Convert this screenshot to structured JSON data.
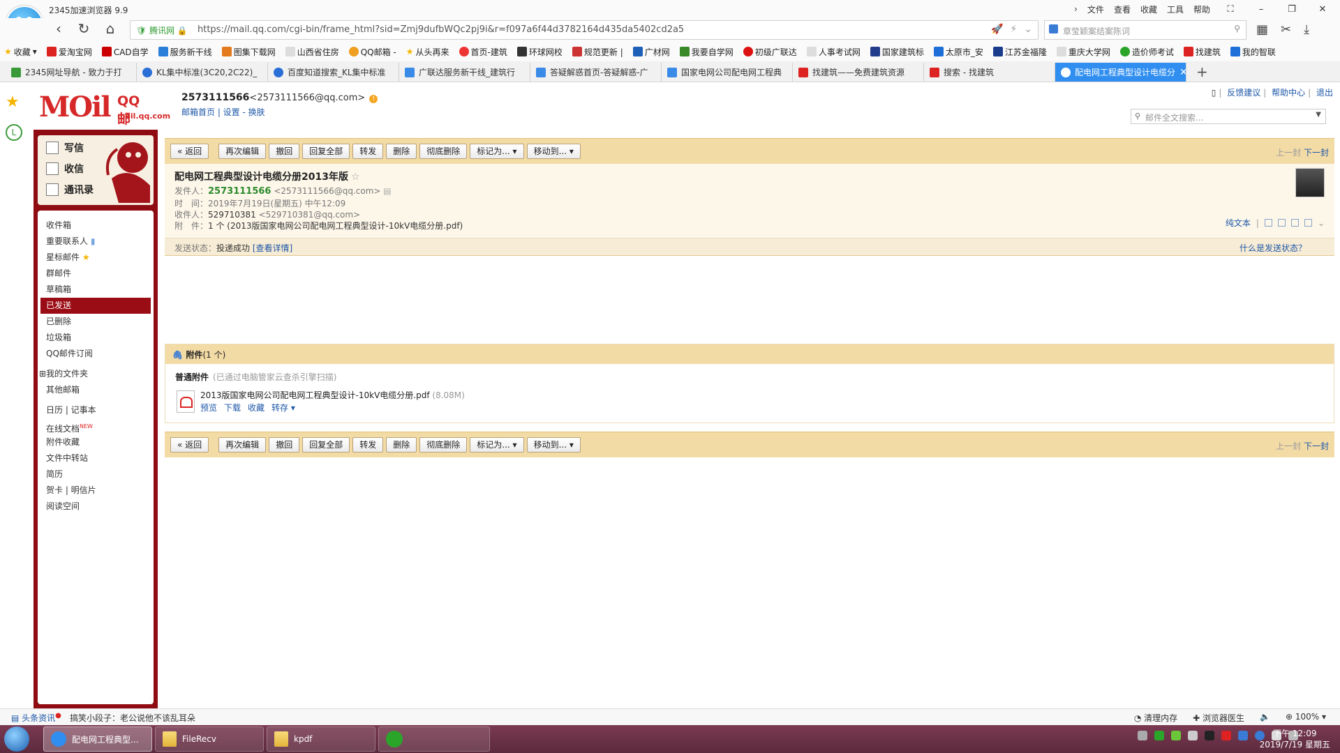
{
  "browser": {
    "title": "2345加速浏览器 9.9",
    "menu": [
      "文件",
      "查看",
      "收藏",
      "工具",
      "帮助"
    ],
    "secure_label": "腾讯网",
    "url": "https://mail.qq.com/cgi-bin/frame_html?sid=Zmj9dufbWQc2pj9i&r=f097a6f44d3782164d435da5402cd2a5",
    "search_placeholder": "章莹颖案结案陈词",
    "bookmarks": [
      "收藏",
      "爱淘宝网",
      "CAD自学",
      "服务新干线",
      "图集下载网",
      "山西省住房",
      "QQ邮箱 -",
      "从头再来",
      "首页-建筑",
      "环球网校",
      "规范更新 |",
      "广材网",
      "我要自学网",
      "初级广联达",
      "人事考试网",
      "国家建筑标",
      "太原市_安",
      "江苏金福隆",
      "重庆大学网",
      "造价师考试",
      "找建筑",
      "我的智联"
    ],
    "tabs": [
      {
        "label": "2345网址导航 - 致力于打"
      },
      {
        "label": "KL集中标准(3C20,2C22)_"
      },
      {
        "label": "百度知道搜索_KL集中标准"
      },
      {
        "label": "广联达服务新干线_建筑行"
      },
      {
        "label": "答疑解惑首页-答疑解惑-广"
      },
      {
        "label": "国家电网公司配电网工程典"
      },
      {
        "label": "找建筑——免费建筑资源"
      },
      {
        "label": "搜索 - 找建筑"
      },
      {
        "label": "配电网工程典型设计电缆分"
      }
    ]
  },
  "mail": {
    "logo_text": "MOil",
    "brand": "QQ邮箱",
    "domain": "mail.qq.com",
    "account_name": "2573111566",
    "account_email": "<2573111566@qq.com>",
    "account_links": "邮箱首页 | 设置 - 换肤",
    "top_links": [
      "反馈建议",
      "帮助中心",
      "退出"
    ],
    "search_placeholder": "邮件全文搜索...",
    "compose": [
      "写信",
      "收信",
      "通讯录"
    ],
    "folders": [
      "收件箱",
      "重要联系人",
      "星标邮件",
      "群邮件",
      "草稿箱",
      "已发送",
      "已删除",
      "垃圾箱",
      "QQ邮件订阅"
    ],
    "folders2": [
      "我的文件夹",
      "其他邮箱"
    ],
    "tools": [
      "日历 | 记事本",
      "在线文档",
      "附件收藏",
      "文件中转站",
      "简历",
      "贺卡 | 明信片",
      "阅读空间"
    ],
    "toolbar": [
      "« 返回",
      "再次编辑",
      "撤回",
      "回复全部",
      "转发",
      "删除",
      "彻底删除",
      "标记为...",
      "移动到..."
    ],
    "pager_prev": "上一封",
    "pager_next": "下一封",
    "subject": "配电网工程典型设计电缆分册2013年版",
    "from_label": "发件人：",
    "from_name": "2573111566",
    "from_email": "<2573111566@qq.com>",
    "time_label": "时　间：",
    "time_value": "2019年7月19日(星期五) 中午12:09",
    "to_label": "收件人：",
    "to_name": "529710381",
    "to_email": "<529710381@qq.com>",
    "att_label": "附　件：",
    "att_count": "1 个",
    "att_inline": "(2013版国家电网公司配电网工程典型设计-10kV电缆分册.pdf)",
    "plain_text": "纯文本",
    "status_label": "发送状态：",
    "status_value": "投递成功",
    "status_link": "[查看详情]",
    "status_help": "什么是发送状态？",
    "att_section_title": "附件",
    "att_section_count": "(1 个)",
    "att_sub": "普通附件",
    "att_scan": "(已通过电脑管家云查杀引擎扫描)",
    "att_file": "2013版国家电网公司配电网工程典型设计-10kV电缆分册.pdf",
    "att_size": "(8.08M)",
    "att_actions": [
      "预览",
      "下载",
      "收藏",
      "转存"
    ]
  },
  "statusbar": {
    "news": "头条资讯",
    "joke": "搞笑小段子：老公说他不该乱耳朵",
    "right": [
      "清理内存",
      "浏览器医生",
      "100%"
    ]
  },
  "taskbar": {
    "tasks": [
      "配电网工程典型...",
      "FileRecv",
      "kpdf"
    ],
    "time": "下午 12:09",
    "date": "2019/7/19 星期五"
  },
  "colors": {
    "accent_red": "#9b0d14",
    "toolbar_tan": "#f3dba6",
    "link_blue": "#1d57a8"
  }
}
